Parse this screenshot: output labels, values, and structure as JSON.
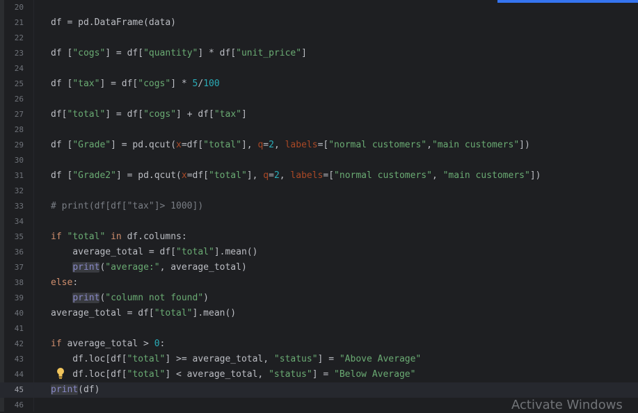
{
  "editor": {
    "current_line": "45",
    "lines": [
      {
        "n": "20",
        "segments": []
      },
      {
        "n": "21",
        "segments": [
          {
            "t": "df = pd.DataFrame(data)"
          }
        ]
      },
      {
        "n": "22",
        "segments": []
      },
      {
        "n": "23",
        "segments": [
          {
            "t": "df ["
          },
          {
            "t": "\"cogs\"",
            "c": "str"
          },
          {
            "t": "] = df["
          },
          {
            "t": "\"quantity\"",
            "c": "str"
          },
          {
            "t": "] * df["
          },
          {
            "t": "\"unit_price\"",
            "c": "str"
          },
          {
            "t": "]"
          }
        ]
      },
      {
        "n": "24",
        "segments": []
      },
      {
        "n": "25",
        "segments": [
          {
            "t": "df ["
          },
          {
            "t": "\"tax\"",
            "c": "str"
          },
          {
            "t": "] = df["
          },
          {
            "t": "\"cogs\"",
            "c": "str"
          },
          {
            "t": "] * "
          },
          {
            "t": "5",
            "c": "num"
          },
          {
            "t": "/"
          },
          {
            "t": "100",
            "c": "num"
          }
        ]
      },
      {
        "n": "26",
        "segments": []
      },
      {
        "n": "27",
        "segments": [
          {
            "t": "df["
          },
          {
            "t": "\"total\"",
            "c": "str"
          },
          {
            "t": "] = df["
          },
          {
            "t": "\"cogs\"",
            "c": "str"
          },
          {
            "t": "] + df["
          },
          {
            "t": "\"tax\"",
            "c": "str"
          },
          {
            "t": "]"
          }
        ]
      },
      {
        "n": "28",
        "segments": []
      },
      {
        "n": "29",
        "segments": [
          {
            "t": "df ["
          },
          {
            "t": "\"Grade\"",
            "c": "str"
          },
          {
            "t": "] = pd.qcut("
          },
          {
            "t": "x",
            "c": "param"
          },
          {
            "t": "=df["
          },
          {
            "t": "\"total\"",
            "c": "str"
          },
          {
            "t": "], "
          },
          {
            "t": "q",
            "c": "param"
          },
          {
            "t": "="
          },
          {
            "t": "2",
            "c": "num"
          },
          {
            "t": ", "
          },
          {
            "t": "labels",
            "c": "param"
          },
          {
            "t": "=["
          },
          {
            "t": "\"normal customers\"",
            "c": "str"
          },
          {
            "t": ","
          },
          {
            "t": "\"main customers\"",
            "c": "str"
          },
          {
            "t": "])"
          }
        ]
      },
      {
        "n": "30",
        "segments": []
      },
      {
        "n": "31",
        "segments": [
          {
            "t": "df ["
          },
          {
            "t": "\"Grade2\"",
            "c": "str"
          },
          {
            "t": "] = pd.qcut("
          },
          {
            "t": "x",
            "c": "param"
          },
          {
            "t": "=df["
          },
          {
            "t": "\"total\"",
            "c": "str"
          },
          {
            "t": "], "
          },
          {
            "t": "q",
            "c": "param"
          },
          {
            "t": "="
          },
          {
            "t": "2",
            "c": "num"
          },
          {
            "t": ", "
          },
          {
            "t": "labels",
            "c": "param"
          },
          {
            "t": "=["
          },
          {
            "t": "\"normal customers\"",
            "c": "str"
          },
          {
            "t": ", "
          },
          {
            "t": "\"main customers\"",
            "c": "str"
          },
          {
            "t": "])"
          }
        ]
      },
      {
        "n": "32",
        "segments": []
      },
      {
        "n": "33",
        "segments": [
          {
            "t": "# print(df[df[\"tax\"]> 1000])",
            "c": "comment"
          }
        ]
      },
      {
        "n": "34",
        "segments": []
      },
      {
        "n": "35",
        "segments": [
          {
            "t": "if",
            "c": "kw"
          },
          {
            "t": " "
          },
          {
            "t": "\"total\"",
            "c": "str"
          },
          {
            "t": " "
          },
          {
            "t": "in",
            "c": "kw"
          },
          {
            "t": " df.columns:"
          }
        ]
      },
      {
        "n": "36",
        "segments": [
          {
            "t": "    average_total = df["
          },
          {
            "t": "\"total\"",
            "c": "str"
          },
          {
            "t": "].mean()"
          }
        ]
      },
      {
        "n": "37",
        "segments": [
          {
            "t": "    "
          },
          {
            "t": "print",
            "c": "builtin"
          },
          {
            "t": "("
          },
          {
            "t": "\"average:\"",
            "c": "str"
          },
          {
            "t": ", average_total)"
          }
        ]
      },
      {
        "n": "38",
        "segments": [
          {
            "t": "else",
            "c": "kw"
          },
          {
            "t": ":"
          }
        ]
      },
      {
        "n": "39",
        "segments": [
          {
            "t": "    "
          },
          {
            "t": "print",
            "c": "builtin"
          },
          {
            "t": "("
          },
          {
            "t": "\"column not found\"",
            "c": "str"
          },
          {
            "t": ")"
          }
        ]
      },
      {
        "n": "40",
        "segments": [
          {
            "t": "average_total = df["
          },
          {
            "t": "\"total\"",
            "c": "str"
          },
          {
            "t": "].mean()"
          }
        ]
      },
      {
        "n": "41",
        "segments": []
      },
      {
        "n": "42",
        "segments": [
          {
            "t": "if",
            "c": "kw"
          },
          {
            "t": " average_total > "
          },
          {
            "t": "0",
            "c": "num"
          },
          {
            "t": ":"
          }
        ]
      },
      {
        "n": "43",
        "segments": [
          {
            "t": "    df.loc[df["
          },
          {
            "t": "\"total\"",
            "c": "str"
          },
          {
            "t": "] >= average_total, "
          },
          {
            "t": "\"status\"",
            "c": "str"
          },
          {
            "t": "] = "
          },
          {
            "t": "\"Above Average\"",
            "c": "str"
          }
        ]
      },
      {
        "n": "44",
        "segments": [
          {
            "t": "    df.loc[df["
          },
          {
            "t": "\"total\"",
            "c": "str"
          },
          {
            "t": "] < average_total, "
          },
          {
            "t": "\"status\"",
            "c": "str"
          },
          {
            "t": "] = "
          },
          {
            "t": "\"Below Average\"",
            "c": "str"
          }
        ]
      },
      {
        "n": "45",
        "segments": [
          {
            "t": "print",
            "c": "builtin"
          },
          {
            "t": "(df)"
          }
        ]
      },
      {
        "n": "46",
        "segments": []
      }
    ]
  },
  "icons": {
    "intention": "lightbulb-icon"
  },
  "colors": {
    "accent": "#3574f0",
    "string": "#6aab73",
    "keyword": "#cf8e6d",
    "number": "#2aacb8",
    "param": "#aa4926",
    "comment": "#7a7e85",
    "builtin": "#8888c6"
  },
  "watermark": "Activate Windows"
}
